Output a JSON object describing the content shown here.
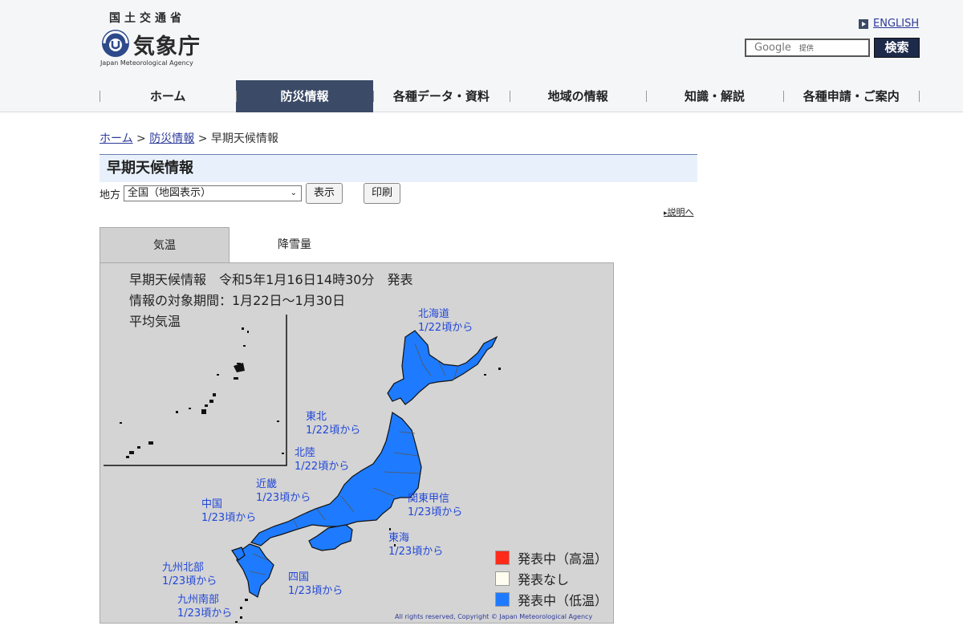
{
  "header": {
    "ministry": "国土交通省",
    "agency": "気象庁",
    "agency_en": "Japan Meteorological Agency",
    "english_link": "ENGLISH",
    "search_brand": "Google",
    "search_sub": "提供",
    "search_button": "検索"
  },
  "nav": {
    "items": [
      {
        "label": "ホーム"
      },
      {
        "label": "防災情報"
      },
      {
        "label": "各種データ・資料"
      },
      {
        "label": "地域の情報"
      },
      {
        "label": "知識・解説"
      },
      {
        "label": "各種申請・ご案内"
      }
    ],
    "active_index": 1
  },
  "breadcrumb": {
    "home": "ホーム",
    "sep1": ">",
    "bousai": "防災情報",
    "sep2": ">",
    "current": "早期天候情報"
  },
  "page_title": "早期天候情報",
  "controls": {
    "region_label": "地方",
    "region_value": "全国（地図表示）",
    "show_button": "表示",
    "print_button": "印刷"
  },
  "explanation_link": "説明へ",
  "tabs": [
    {
      "label": "気温"
    },
    {
      "label": "降雪量"
    }
  ],
  "map": {
    "info_line1": "早期天候情報　令和5年1月16日14時30分　発表",
    "info_line2": "情報の対象期間：1月22日～1月30日",
    "info_line3": "平均気温",
    "regions": [
      {
        "name": "北海道",
        "date": "1/22頃から"
      },
      {
        "name": "東北",
        "date": "1/22頃から"
      },
      {
        "name": "北陸",
        "date": "1/22頃から"
      },
      {
        "name": "近畿",
        "date": "1/23頃から"
      },
      {
        "name": "中国",
        "date": "1/23頃から"
      },
      {
        "name": "関東甲信",
        "date": "1/23頃から"
      },
      {
        "name": "東海",
        "date": "1/23頃から"
      },
      {
        "name": "四国",
        "date": "1/23頃から"
      },
      {
        "name": "九州北部",
        "date": "1/23頃から"
      },
      {
        "name": "九州南部",
        "date": "1/23頃から"
      }
    ],
    "legend": [
      {
        "label": "発表中（高温）",
        "color": "#ff2a1a"
      },
      {
        "label": "発表なし",
        "color": "#fffdf0"
      },
      {
        "label": "発表中（低温）",
        "color": "#1e7bff"
      }
    ],
    "land_color": "#1e7bff",
    "copyright": "All rights reserved, Copyright © Japan Meteorological Agency"
  }
}
